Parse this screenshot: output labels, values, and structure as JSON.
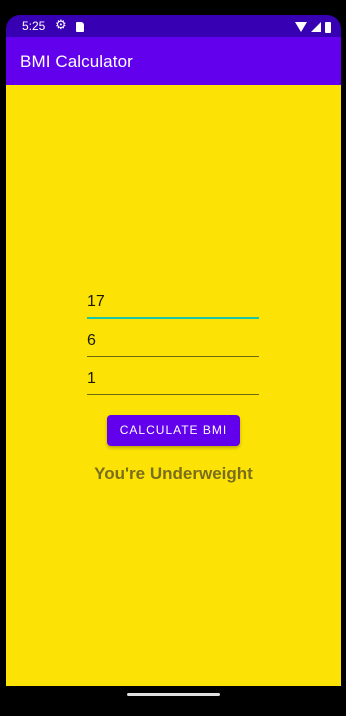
{
  "status_bar": {
    "time": "5:25",
    "icons": [
      "settings-icon",
      "sim-card-icon",
      "wifi-icon",
      "signal-icon",
      "battery-icon"
    ]
  },
  "app_bar": {
    "title": "BMI Calculator"
  },
  "form": {
    "fields": [
      {
        "value": "17"
      },
      {
        "value": "6"
      },
      {
        "value": "1"
      }
    ],
    "calculate_label": "CALCULATE BMI"
  },
  "result": {
    "text": "You're Underweight"
  },
  "colors": {
    "status_bar": "#3700b3",
    "primary": "#6200ee",
    "background": "#fce305",
    "focus_underline": "#18c8a8",
    "result_text": "#7a6e1c"
  }
}
